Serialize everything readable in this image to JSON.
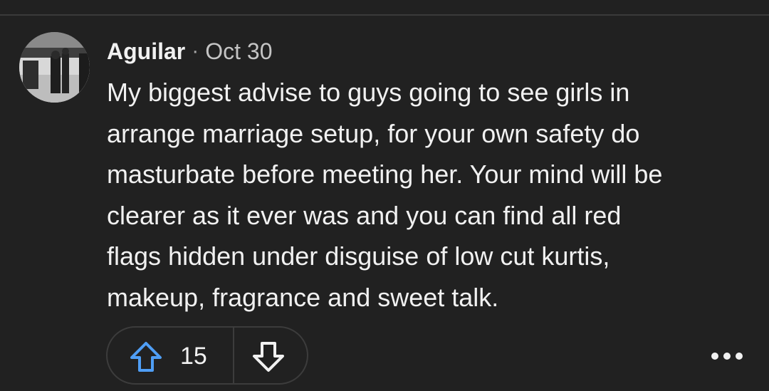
{
  "comment": {
    "author": "Aguilar",
    "separator": "·",
    "date": "Oct 30",
    "body_lines": [
      "My biggest advise to guys going to see girls in",
      "arrange marriage setup, for your own safety do",
      "masturbate before meeting her. Your mind will be",
      "clearer as it ever was and you can find all red",
      "flags hidden under disguise of low cut kurtis,",
      "makeup, fragrance and sweet talk."
    ],
    "score": "15"
  },
  "icons": {
    "upvote": "arrow-up-icon",
    "downvote": "arrow-down-icon",
    "more": "more-horizontal-icon"
  },
  "colors": {
    "background": "#212121",
    "text": "#f1f1f1",
    "upvote_accent": "#4f9ef5"
  }
}
